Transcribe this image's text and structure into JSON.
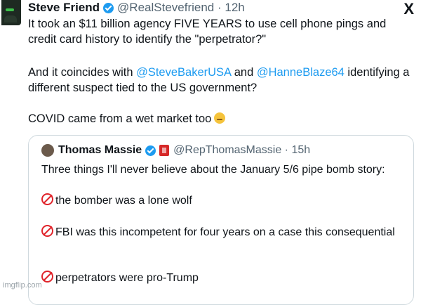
{
  "tweet": {
    "author_name": "Steve Friend",
    "handle": "@RealStevefriend",
    "time": "12h",
    "p1": "It took an $11 billion agency FIVE YEARS to use cell phone pings and credit card history to identify the \"perpetrator?\"",
    "p2_a": "And it coincides with ",
    "p2_link1": "@SteveBakerUSA",
    "p2_b": " and ",
    "p2_link2": "@HanneBlaze64",
    "p2_c": " identifying a different suspect tied to the US government?",
    "p3": "COVID came from a wet market too",
    "p3_emoji": "woozy-face-emoji"
  },
  "quote": {
    "author_name": "Thomas Massie",
    "handle": "@RepThomasMassie",
    "time": "15h",
    "intro": "Three things I'll never believe about the January 5/6 pipe bomb story:",
    "items": [
      "the bomber was a lone wolf",
      "FBI was this incompetent for four years on a case this consequential",
      "perpetrators were pro-Trump"
    ],
    "item_icon": "no-entry-icon"
  },
  "watermark": "imgflip.com",
  "brand_logo": "X",
  "colors": {
    "link": "#1d9bf0",
    "verified": "#1d9bf0",
    "muted": "#536471",
    "no_entry": "#e0242b"
  }
}
